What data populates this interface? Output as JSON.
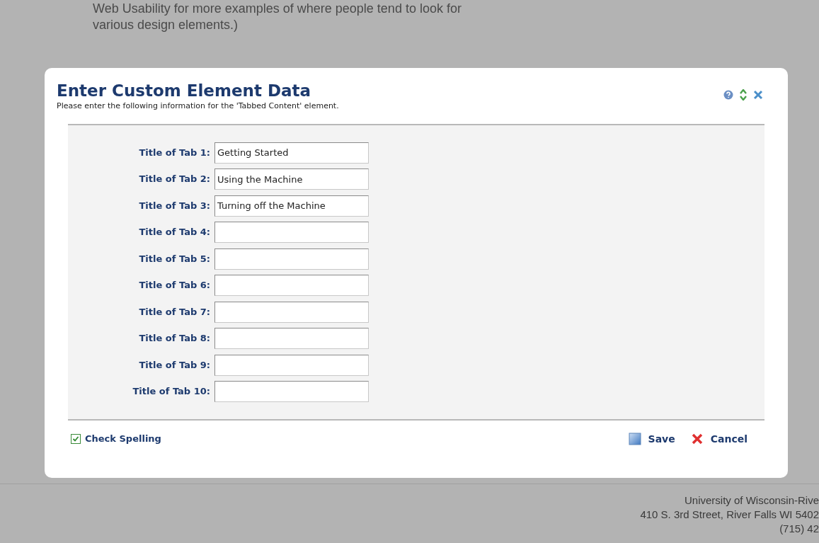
{
  "background_text": [
    "Web Usability for more examples of where people tend to look for",
    "various design elements.)"
  ],
  "dialog": {
    "title": "Enter Custom Element Data",
    "subtitle": "Please enter the following information for the 'Tabbed Content' element.",
    "fields": [
      {
        "label": "Title of Tab 1:",
        "value": "Getting Started"
      },
      {
        "label": "Title of Tab 2:",
        "value": "Using the Machine"
      },
      {
        "label": "Title of Tab 3:",
        "value": "Turning off the Machine"
      },
      {
        "label": "Title of Tab 4:"
      },
      {
        "label": "Title of Tab 5:"
      },
      {
        "label": "Title of Tab 6:"
      },
      {
        "label": "Title of Tab 7:"
      },
      {
        "label": "Title of Tab 8:"
      },
      {
        "label": "Title of Tab 9:"
      },
      {
        "label": "Title of Tab 10:"
      }
    ],
    "check_spelling": {
      "label": "Check Spelling",
      "checked": true
    },
    "buttons": [
      {
        "label": "Save",
        "kind": "save"
      },
      {
        "label": "Cancel",
        "kind": "cancel"
      }
    ]
  },
  "footer": [
    "University of Wisconsin-Rive",
    "410 S. 3rd Street, River Falls WI 5402",
    "(715) 42"
  ]
}
